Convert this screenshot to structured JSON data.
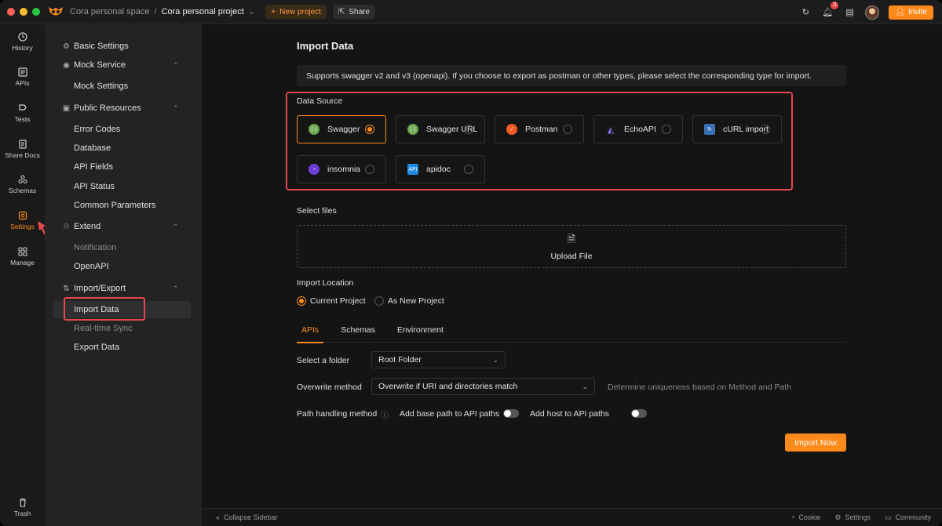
{
  "titlebar": {
    "workspace": "Cora personal space",
    "separator": "/",
    "project": "Cora personal project",
    "new_project": "New project",
    "share": "Share",
    "notification_count": "3",
    "invite": "Invite"
  },
  "rail": {
    "history": "History",
    "apis": "APIs",
    "tests": "Tests",
    "share_docs": "Share Docs",
    "schemas": "Schemas",
    "settings": "Settings",
    "manage": "Manage",
    "trash": "Trash"
  },
  "sidebar": {
    "basic_settings": "Basic Settings",
    "mock_service": "Mock Service",
    "mock_settings": "Mock Settings",
    "public_resources": "Public Resources",
    "error_codes": "Error Codes",
    "database": "Database",
    "api_fields": "API Fields",
    "api_status": "API Status",
    "common_parameters": "Common Parameters",
    "extend": "Extend",
    "notification": "Notification",
    "openapi": "OpenAPI",
    "import_export": "Import/Export",
    "import_data": "Import Data",
    "realtime_sync": "Real-time Sync",
    "export_data": "Export Data"
  },
  "main": {
    "title": "Import Data",
    "notice": "Supports swagger v2 and v3 (openapi). If you choose to export as postman or other types, please select the corresponding type for import.",
    "data_source_label": "Data Source",
    "sources": [
      {
        "name": "Swagger",
        "selected": true
      },
      {
        "name": "Swagger URL",
        "selected": false
      },
      {
        "name": "Postman",
        "selected": false
      },
      {
        "name": "EchoAPI",
        "selected": false
      },
      {
        "name": "cURL import",
        "selected": false
      },
      {
        "name": "insomnia",
        "selected": false
      },
      {
        "name": "apidoc",
        "selected": false
      }
    ],
    "select_files_label": "Select files",
    "upload_label": "Upload File",
    "import_location_label": "Import Location",
    "location_current": "Current Project",
    "location_new": "As New Project",
    "tabs": [
      "APIs",
      "Schemas",
      "Environment"
    ],
    "folder_label": "Select a folder",
    "folder_value": "Root Folder",
    "overwrite_label": "Overwrite method",
    "overwrite_value": "Overwrite if URI and directories match",
    "overwrite_hint": "Determine uniqueness based on Method and Path",
    "path_label": "Path handling method",
    "base_path_label": "Add base path to API paths",
    "host_label": "Add host to API paths",
    "import_button": "Import Now"
  },
  "footer": {
    "collapse": "Collapse Sidebar",
    "cookie": "Cookie",
    "settings": "Settings",
    "community": "Community"
  },
  "colors": {
    "accent": "#ff8a1c",
    "annotation": "#e5484d"
  }
}
